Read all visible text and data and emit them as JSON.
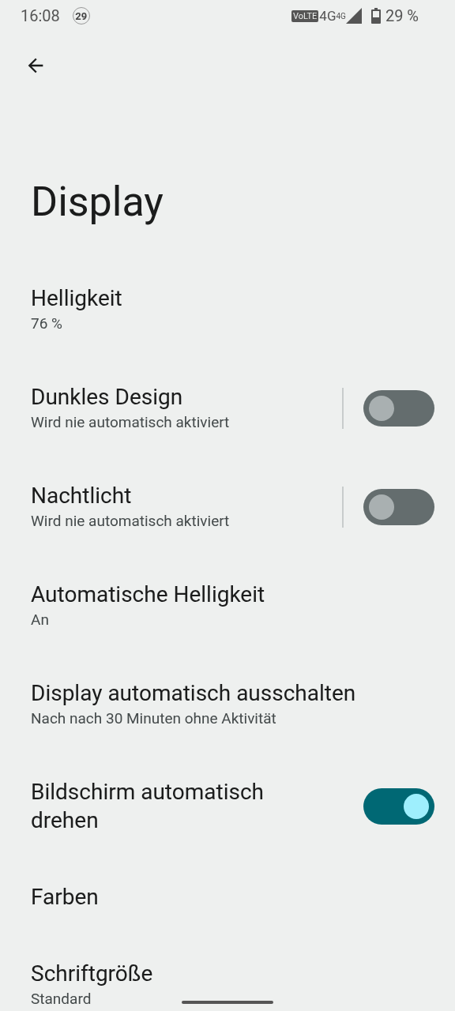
{
  "status_bar": {
    "time": "16:08",
    "notification_count": "29",
    "network_badge": "VoLTE",
    "network": "4G",
    "network_secondary": "4G",
    "battery": "29 %"
  },
  "title": "Display",
  "settings": [
    {
      "kind": "plain",
      "title": "Helligkeit",
      "summary": "76 %"
    },
    {
      "kind": "toggle",
      "title": "Dunkles Design",
      "summary": "Wird nie automatisch aktiviert",
      "divider": true,
      "on": false
    },
    {
      "kind": "toggle",
      "title": "Nachtlicht",
      "summary": "Wird nie automatisch aktiviert",
      "divider": true,
      "on": false
    },
    {
      "kind": "plain",
      "title": "Automatische Helligkeit",
      "summary": "An"
    },
    {
      "kind": "plain",
      "title": "Display automatisch ausschalten",
      "summary": "Nach nach 30 Minuten ohne Aktivität"
    },
    {
      "kind": "toggle",
      "title": "Bildschirm automatisch drehen",
      "on": true
    },
    {
      "kind": "plain",
      "title": "Farben"
    },
    {
      "kind": "plain",
      "title": "Schriftgröße",
      "summary": "Standard"
    }
  ]
}
